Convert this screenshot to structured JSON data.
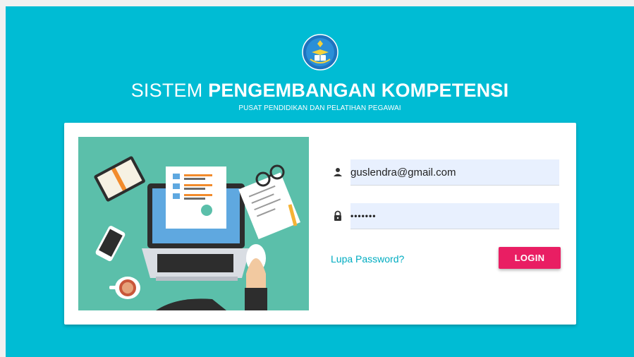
{
  "header": {
    "title_light": "SISTEM",
    "title_bold": "PENGEMBANGAN KOMPETENSI",
    "subtitle": "PUSAT PENDIDIKAN DAN PELATIHAN PEGAWAI",
    "logo_icon": "tut-wuri-handayani-emblem-icon"
  },
  "login_form": {
    "email_icon": "person-icon",
    "email_value": "guslendra@gmail.com",
    "password_icon": "lock-icon",
    "password_value": "•••••••",
    "forgot_password_label": "Lupa Password?",
    "login_label": "LOGIN"
  },
  "illustration_icon": "laptop-checklist-illustration",
  "colors": {
    "background": "#00bcd4",
    "card": "#ffffff",
    "button": "#e91e63",
    "link": "#00acc1",
    "input_fill": "#e8f0fe",
    "illustration_bg": "#5bbfaa"
  }
}
